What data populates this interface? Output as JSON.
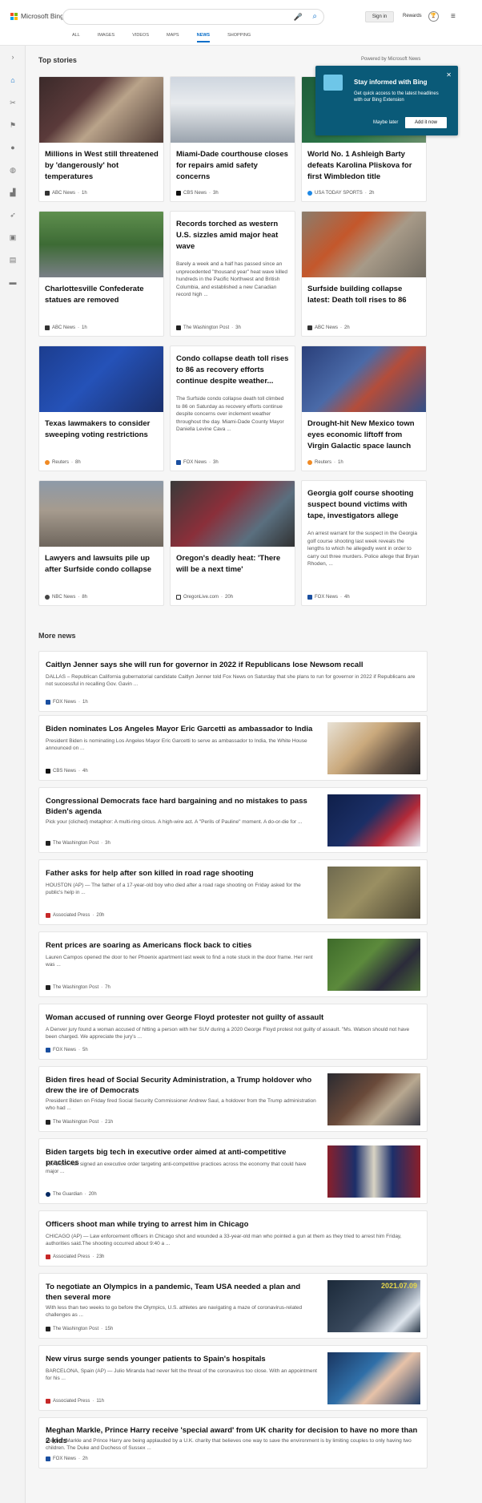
{
  "header": {
    "logo_text": "Microsoft Bing",
    "search_value": "",
    "signin_label": "Sign in",
    "rewards_label": "Rewards",
    "nav_tabs": [
      "ALL",
      "IMAGES",
      "VIDEOS",
      "MAPS",
      "NEWS",
      "SHOPPING"
    ],
    "active_tab": "NEWS",
    "accent_color": "#0b6fc9"
  },
  "top_stories": {
    "title": "Top stories",
    "powered": "Powered by Microsoft News",
    "cards": [
      {
        "title": "Millions in West still threatened by 'dangerously' hot temperatures",
        "source": "ABC News",
        "time": "1h"
      },
      {
        "title": "Miami-Dade courthouse closes for repairs amid safety concerns",
        "source": "CBS News",
        "time": "3h"
      },
      {
        "title": "World No. 1 Ashleigh Barty defeats Karolina Pliskova for first Wimbledon title",
        "source": "USA TODAY SPORTS",
        "time": "2h"
      },
      {
        "title": "Charlottesville Confederate statues are removed",
        "source": "ABC News",
        "time": "1h"
      },
      {
        "title": "Records torched as western U.S. sizzles amid major heat wave",
        "snippet": "Barely a week and a half has passed since an unprecedented \"thousand year\" heat wave killed hundreds in the Pacific Northwest and British Columbia, and established a new Canadian record high ...",
        "source": "The Washington Post",
        "time": "3h"
      },
      {
        "title": "Surfside building collapse latest: Death toll rises to 86",
        "source": "ABC News",
        "time": "2h"
      },
      {
        "title": "Texas lawmakers to consider sweeping voting restrictions",
        "source": "Reuters",
        "time": "8h"
      },
      {
        "title": "Condo collapse death toll rises to 86 as recovery efforts continue despite weather...",
        "snippet": "The Surfside condo collapse death toll climbed to 86 on Saturday as recovery efforts continue despite concerns over inclement weather throughout the day. Miami-Dade County Mayor Daniella Levine Cava ...",
        "source": "FOX News",
        "time": "3h"
      },
      {
        "title": "Drought-hit New Mexico town eyes economic liftoff from Virgin Galactic space launch",
        "source": "Reuters",
        "time": "1h"
      },
      {
        "title": "Lawyers and lawsuits pile up after Surfside condo collapse",
        "source": "NBC News",
        "time": "8h"
      },
      {
        "title": "Oregon's deadly heat: 'There will be a next time'",
        "source": "OregonLive.com",
        "time": "20h"
      },
      {
        "title": "Georgia golf course shooting suspect bound victims with tape, investigators allege",
        "snippet": "An arrest warrant for the suspect in the Georgia golf course shooting last week reveals the lengths to which he allegedly went in order to carry out three murders. Police allege that Bryan Rhoden, ...",
        "source": "FOX News",
        "time": "4h"
      }
    ]
  },
  "popup": {
    "title": "Stay informed with Bing",
    "desc": "Get quick access to the latest headlines with our Bing Extension",
    "later": "Maybe later",
    "add": "Add it now"
  },
  "more_news": {
    "title": "More news",
    "items": [
      {
        "title": "Caitlyn Jenner says she will run for governor in 2022 if Republicans lose Newsom recall",
        "snippet": "DALLAS – Republican California gubernatorial candidate Caitlyn Jenner told Fox News on Saturday that she plans to run for governor in 2022 if Republicans are not successful in recalling Gov. Gavin ...",
        "source": "FOX News",
        "time": "1h"
      },
      {
        "title": "Biden nominates Los Angeles Mayor Eric Garcetti as ambassador to India",
        "snippet": "President Biden is nominating Los Angeles Mayor Eric Garcetti to serve as ambassador to India, the White House announced on ...",
        "source": "CBS News",
        "time": "4h"
      },
      {
        "title": "Congressional Democrats face hard bargaining and no mistakes to pass Biden's agenda",
        "snippet": "Pick your (cliched) metaphor: A multi-ring circus. A high-wire act. A \"Perils of Pauline\" moment. A do-or-die for ...",
        "source": "The Washington Post",
        "time": "3h"
      },
      {
        "title": "Father asks for help after son killed in road rage shooting",
        "snippet": "HOUSTON (AP) — The father of a 17-year-old boy who died after a road rage shooting on Friday asked for the public's help in ...",
        "source": "Associated Press",
        "time": "20h"
      },
      {
        "title": "Rent prices are soaring as Americans flock back to cities",
        "snippet": "Lauren Campos opened the door to her Phoenix apartment last week to find a note stuck in the door frame. Her rent was ...",
        "source": "The Washington Post",
        "time": "7h"
      },
      {
        "title": "Woman accused of running over George Floyd protester not guilty of assault",
        "snippet": "A Denver jury found a woman accused of hitting a person with her SUV during a 2020 George Floyd protest not guilty of assault. \"Ms. Watson should not have been charged. We appreciate the jury's ...",
        "source": "FOX News",
        "time": "5h"
      },
      {
        "title": "Biden fires head of Social Security Administration, a Trump holdover who drew the ire of Democrats",
        "snippet": "President Biden on Friday fired Social Security Commissioner Andrew Saul, a holdover from the Trump administration who had ...",
        "source": "The Washington Post",
        "time": "21h"
      },
      {
        "title": "Biden targets big tech in executive order aimed at anti-competitive practices",
        "snippet": "Joe Biden has signed an executive order targeting anti-competitive practices across the economy that could have major ...",
        "source": "The Guardian",
        "time": "20h"
      },
      {
        "title": "Officers shoot man while trying to arrest him in Chicago",
        "snippet": "CHICAGO (AP) — Law enforcement officers in Chicago shot and wounded a 33-year-old man who pointed a gun at them as they tried to arrest him Friday, authorities said.The shooting occurred about 9:40 a ...",
        "source": "Associated Press",
        "time": "23h"
      },
      {
        "title": "To negotiate an Olympics in a pandemic, Team USA needed a plan and then several more",
        "snippet": "With less than two weeks to go before the Olympics, U.S. athletes are navigating a maze of coronavirus-related challenges as ...",
        "source": "The Washington Post",
        "time": "15h",
        "thumb_text": "2021.07.09"
      },
      {
        "title": "New virus surge sends younger patients to Spain's hospitals",
        "snippet": "BARCELONA, Spain (AP) — Julio Miranda had never felt the threat of the coronavirus too close. With an appointment for his ...",
        "source": "Associated Press",
        "time": "11h"
      },
      {
        "title": "Meghan Markle, Prince Harry receive 'special award' from UK charity for decision to have no more than 2 kids",
        "snippet": "Meghan Markle and Prince Harry are being applauded by a U.K. charity that believes one way to save the environment is by limiting couples to only having two children. The Duke and Duchess of Sussex ...",
        "source": "FOX News",
        "time": "2h"
      }
    ]
  }
}
